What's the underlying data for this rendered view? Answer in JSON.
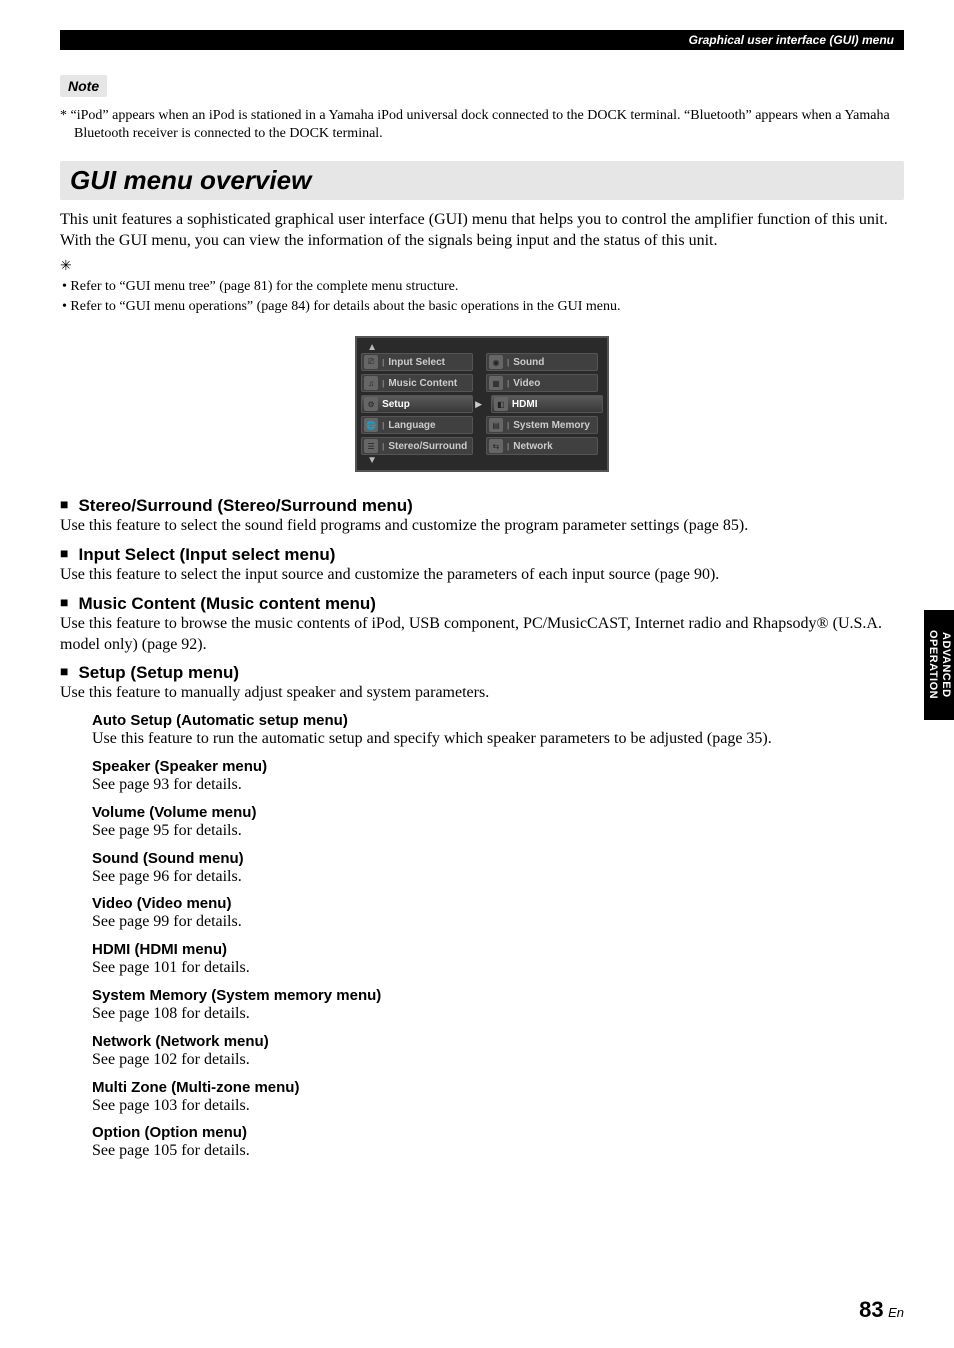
{
  "header": {
    "breadcrumb": "Graphical user interface (GUI) menu"
  },
  "note": {
    "label": "Note",
    "text": "*  “iPod” appears when an iPod is stationed in a Yamaha iPod universal dock connected to the DOCK terminal. “Bluetooth” appears when a Yamaha Bluetooth receiver is connected to the DOCK terminal."
  },
  "section_title": "GUI menu overview",
  "intro": "This unit features a sophisticated graphical user interface (GUI) menu that helps you to control the amplifier function of this unit. With the GUI menu, you can view the information of the signals being input and the status of this unit.",
  "tips": [
    "•  Refer to “GUI menu tree” (page 81) for the complete menu structure.",
    "•  Refer to “GUI menu operations” (page 84) for details about the basic operations in the GUI menu."
  ],
  "gui": {
    "left": [
      "Input Select",
      "Music Content",
      "Setup",
      "Language",
      "Stereo/Surround"
    ],
    "right": [
      "Sound",
      "Video",
      "HDMI",
      "System Memory",
      "Network"
    ],
    "selectedLeft": 2,
    "selectedRight": 2
  },
  "menus": [
    {
      "title": "Stereo/Surround (Stereo/Surround menu)",
      "body": "Use this feature to select the sound field programs and customize the program parameter settings (page 85)."
    },
    {
      "title": "Input Select (Input select menu)",
      "body": "Use this feature to select the input source and customize the parameters of each input source (page 90)."
    },
    {
      "title": "Music Content (Music content menu)",
      "body": "Use this feature to browse the music contents of iPod, USB component, PC/MusicCAST, Internet radio and Rhapsody® (U.S.A. model only) (page 92)."
    },
    {
      "title": "Setup (Setup menu)",
      "body": "Use this feature to manually adjust speaker and system parameters."
    }
  ],
  "setup_items": [
    {
      "title": "Auto Setup (Automatic setup menu)",
      "desc": "Use this feature to run the automatic setup and specify which speaker parameters to be adjusted (page 35)."
    },
    {
      "title": "Speaker (Speaker menu)",
      "desc": "See page 93 for details."
    },
    {
      "title": "Volume (Volume menu)",
      "desc": "See page 95 for details."
    },
    {
      "title": "Sound (Sound menu)",
      "desc": "See page 96 for details."
    },
    {
      "title": "Video (Video menu)",
      "desc": "See page 99 for details."
    },
    {
      "title": "HDMI (HDMI menu)",
      "desc": "See page 101 for details."
    },
    {
      "title": "System Memory (System memory menu)",
      "desc": "See page 108 for details."
    },
    {
      "title": "Network (Network menu)",
      "desc": "See page 102 for details."
    },
    {
      "title": "Multi Zone (Multi-zone menu)",
      "desc": "See page 103 for details."
    },
    {
      "title": "Option (Option menu)",
      "desc": "See page 105 for details."
    }
  ],
  "side_tab": "ADVANCED OPERATION",
  "page": {
    "num": "83",
    "lang": "En"
  }
}
